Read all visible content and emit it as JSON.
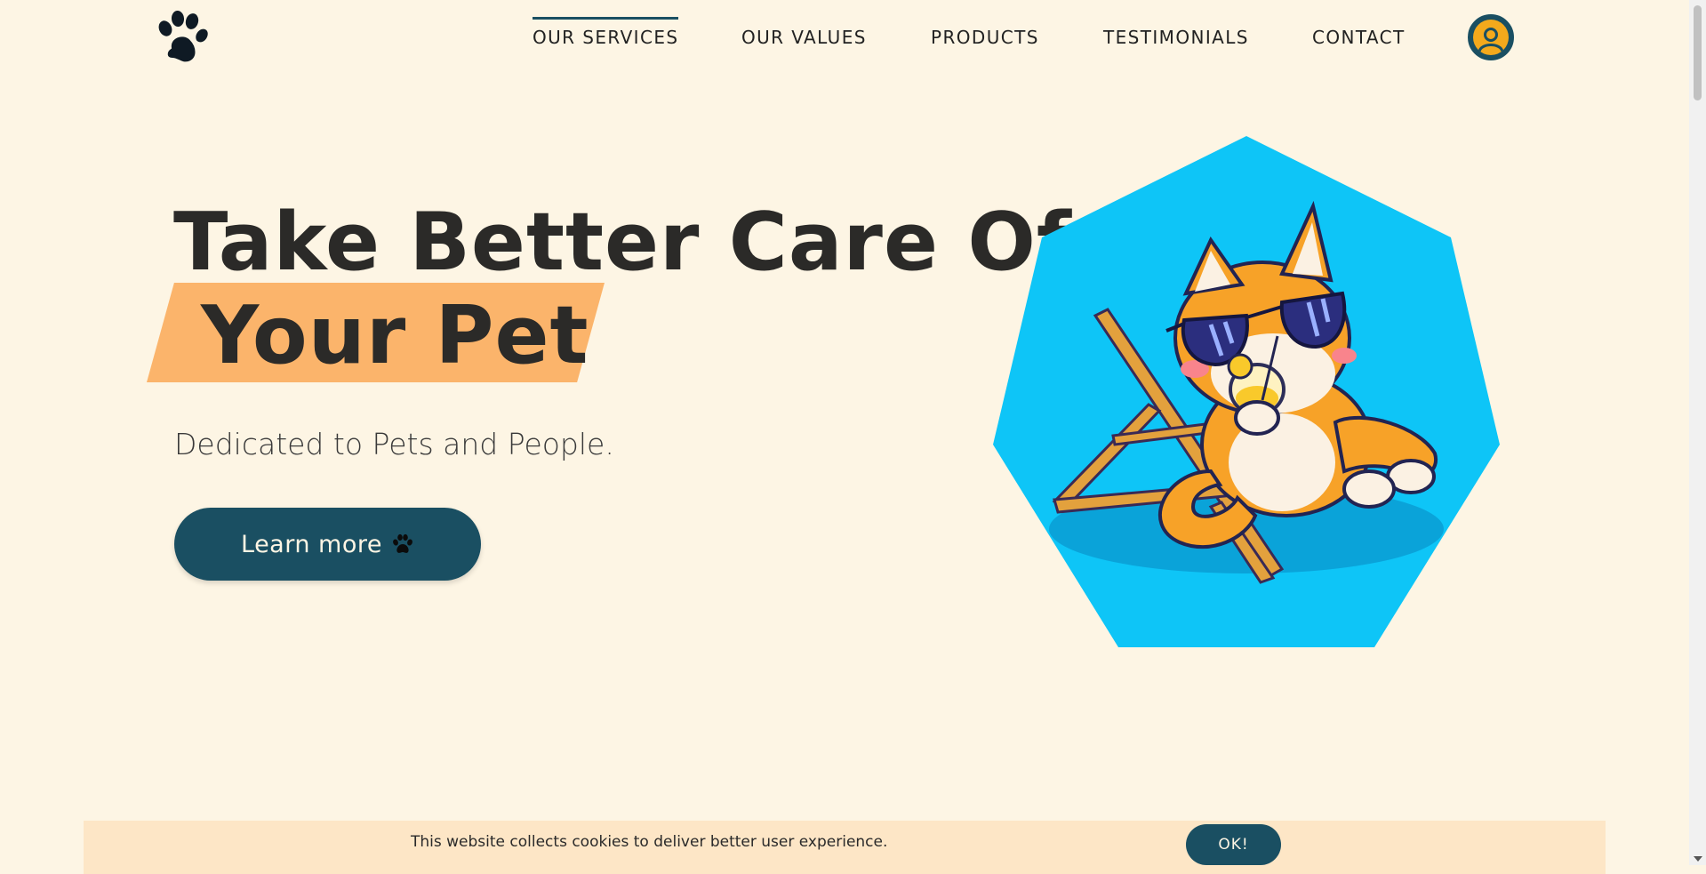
{
  "header": {
    "logo_icon": "paw-icon",
    "nav": [
      {
        "label": "OUR SERVICES",
        "active": true
      },
      {
        "label": "OUR VALUES",
        "active": false
      },
      {
        "label": "PRODUCTS",
        "active": false
      },
      {
        "label": "TESTIMONIALS",
        "active": false
      },
      {
        "label": "CONTACT",
        "active": false
      }
    ],
    "user_icon": "user-icon"
  },
  "hero": {
    "title_line1": "Take Better Care Of",
    "title_line2": "Your Pet",
    "tagline": "Dedicated to Pets and People.",
    "cta_label": "Learn more",
    "cta_icon": "paw-icon",
    "illustration": "shiba-dog-on-beach-chair-illustration"
  },
  "cookie_banner": {
    "text": "This website collects cookies to deliver better user experience.",
    "button_label": "OK!"
  },
  "colors": {
    "background": "#fdf5e4",
    "primary": "#1a4f62",
    "highlight": "#fbb46b",
    "accent": "#f4a91c",
    "sky": "#0ec5f7",
    "cookie_bg": "#fde6c6"
  }
}
